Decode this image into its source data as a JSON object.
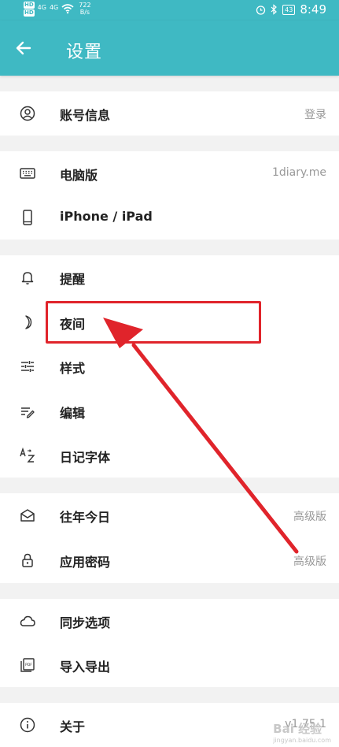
{
  "status_bar": {
    "hd1": "HD",
    "hd2": "HD",
    "signal1": "4G",
    "signal2": "4G",
    "speed_value": "722",
    "speed_unit": "B/s",
    "battery": "43",
    "time": "8:49"
  },
  "header": {
    "title": "设置"
  },
  "rows": {
    "account": {
      "label": "账号信息",
      "value": "登录"
    },
    "desktop": {
      "label": "电脑版",
      "value": "1diary.me"
    },
    "iphone": {
      "label": "iPhone / iPad"
    },
    "reminder": {
      "label": "提醒"
    },
    "night": {
      "label": "夜间"
    },
    "style": {
      "label": "样式"
    },
    "edit": {
      "label": "编辑"
    },
    "font": {
      "label": "日记字体"
    },
    "past_today": {
      "label": "往年今日",
      "value": "高级版"
    },
    "app_password": {
      "label": "应用密码",
      "value": "高级版"
    },
    "sync": {
      "label": "同步选项"
    },
    "import_export": {
      "label": "导入导出"
    },
    "about": {
      "label": "关于",
      "value": "v1.75.1"
    }
  },
  "watermark": {
    "text": "Bai 经验",
    "sub": "jingyan.baidu.com"
  },
  "colors": {
    "primary": "#3fb9c3",
    "annotation": "#e0242b"
  }
}
